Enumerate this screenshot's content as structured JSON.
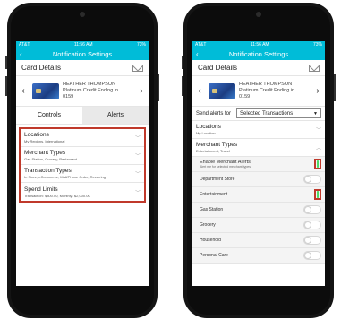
{
  "status_bar": {
    "carrier": "AT&T",
    "time": "11:56 AM",
    "battery": "73%"
  },
  "title": "Notification Settings",
  "card_details": {
    "label": "Card Details",
    "cardholder": "HEATHER THOMPSON",
    "card_name": "Platinum Credit Ending in",
    "card_last4": "0159"
  },
  "left_screen": {
    "tabs": [
      {
        "label": "Controls"
      },
      {
        "label": "Alerts"
      }
    ],
    "items": [
      {
        "title": "Locations",
        "subtitle": "My Regions, International"
      },
      {
        "title": "Merchant Types",
        "subtitle": "Gas Station, Grocery, Restaurant"
      },
      {
        "title": "Transaction Types",
        "subtitle": "In Store, eCommerce, Mail/Phone Order, Recurring"
      },
      {
        "title": "Spend Limits",
        "subtitle": "Transaction: $300.00, Monthly: $2,000.00"
      }
    ]
  },
  "right_screen": {
    "send_alerts_label": "Send alerts for",
    "send_alerts_value": "Selected Transactions",
    "locations": {
      "title": "Locations",
      "subtitle": "My Location"
    },
    "merchant_types": {
      "title": "Merchant Types",
      "subtitle": "Entertainment, Travel"
    },
    "enable": {
      "title": "Enable Merchant Alerts",
      "subtitle": "Alert me for selected merchant types.",
      "on": true
    },
    "merchants": [
      {
        "label": "Department Store",
        "on": false
      },
      {
        "label": "Entertainment",
        "on": true
      },
      {
        "label": "Gas Station",
        "on": false
      },
      {
        "label": "Grocery",
        "on": false
      },
      {
        "label": "Household",
        "on": false
      },
      {
        "label": "Personal Care",
        "on": false
      }
    ]
  },
  "colors": {
    "header": "#00bcd8",
    "highlight": "#c0392b",
    "toggle_on": "#4cd964"
  },
  "icons": {
    "back": "chevron-left-icon",
    "mail": "mail-icon",
    "chevron": "chevron-down-icon"
  }
}
